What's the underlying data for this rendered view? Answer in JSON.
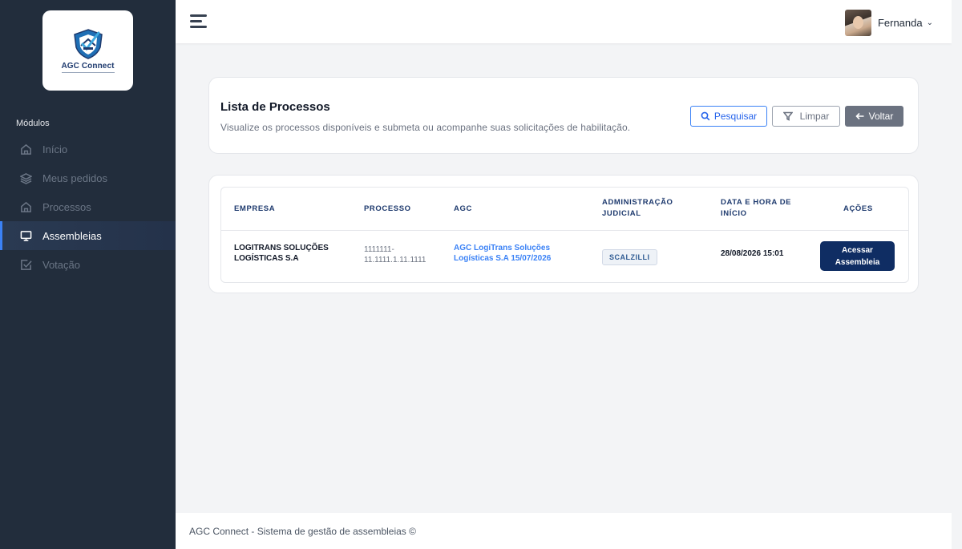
{
  "brand": {
    "name": "AGC Connect"
  },
  "sidebar": {
    "section_label": "Módulos",
    "items": [
      {
        "label": "Início",
        "icon": "home-icon",
        "active": false
      },
      {
        "label": "Meus pedidos",
        "icon": "layers-icon",
        "active": false
      },
      {
        "label": "Processos",
        "icon": "home-icon",
        "active": false
      },
      {
        "label": "Assembleias",
        "icon": "monitor-icon",
        "active": true
      },
      {
        "label": "Votação",
        "icon": "check-square-icon",
        "active": false
      }
    ]
  },
  "topbar": {
    "menu_icon": "hamburger-icon",
    "user_name": "Fernanda",
    "user_chevron": "⌄"
  },
  "header": {
    "title": "Lista de Processos",
    "subtitle": "Visualize os processos disponíveis e submeta ou acompanhe suas solicitações de habilitação.",
    "search_label": "Pesquisar",
    "clear_label": "Limpar",
    "back_label": "Voltar"
  },
  "table": {
    "columns": {
      "empresa": "EMPRESA",
      "processo": "PROCESSO",
      "agc": "AGC",
      "administracao": "ADMINISTRAÇÃO JUDICIAL",
      "data": "DATA E HORA DE INÍCIO",
      "acoes": "AÇÕES"
    },
    "rows": [
      {
        "empresa": "LOGITRANS SOLUÇÕES LOGÍSTICAS S.A",
        "processo": "1111111-11.1111.1.11.1111",
        "agc": "AGC LogiTrans Soluções Logísticas S.A 15/07/2026",
        "administracao": "SCALZILLI",
        "data": "28/08/2026 15:01",
        "acao": "Acessar Assembleia"
      }
    ]
  },
  "footer": {
    "text": "AGC Connect - Sistema de gestão de assembleias ©"
  },
  "colors": {
    "sidebar_bg": "#222d3c",
    "accent": "#3b82f6",
    "primary_dark": "#0f2d63",
    "back_button": "#6b7280"
  }
}
